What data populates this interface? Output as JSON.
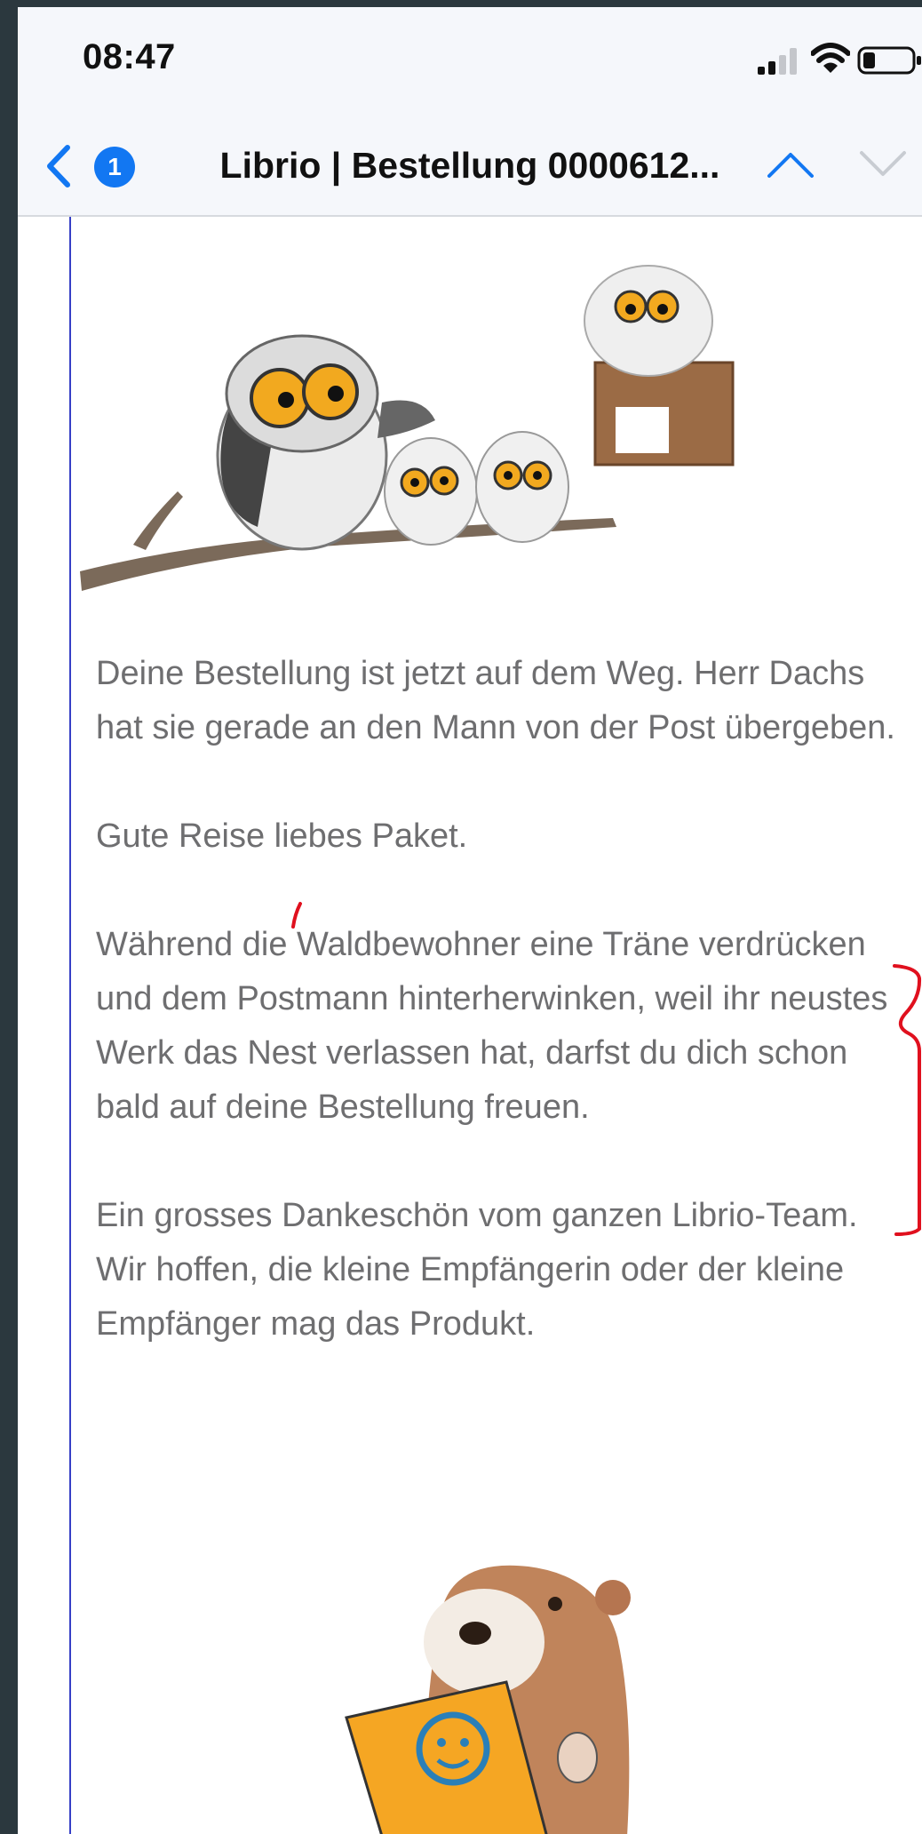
{
  "status_bar": {
    "time": "08:47",
    "signal_icon": "cellular-signal-icon",
    "wifi_icon": "wifi-icon",
    "battery_icon": "battery-low-icon",
    "battery_level": 0.25
  },
  "nav_bar": {
    "back_icon": "chevron-left-icon",
    "unread_count": "1",
    "title": "Librio | Bestellung 0000612...",
    "prev_icon": "chevron-up-icon",
    "next_icon": "chevron-down-icon"
  },
  "illustrations": {
    "header": "owls-on-branch-illustration",
    "footer": "otter-with-clipboard-illustration"
  },
  "email": {
    "paragraphs": [
      "Deine Bestellung ist jetzt auf dem Weg. Herr Dachs hat sie gerade an den Mann von der Post übergeben.",
      "Gute Reise liebes Paket.",
      "Während die Waldbewohner eine Träne verdrücken und dem Postmann hinterherwinken, weil ihr neustes Werk das Nest verlassen hat, darfst du dich schon bald auf deine Bestellung freuen.",
      "Ein grosses Dankeschön vom ganzen Librio-Team. Wir hoffen, die kleine Empfängerin oder der kleine Empfänger mag das Produkt."
    ]
  },
  "annotations": {
    "color": "#e0101e"
  },
  "colors": {
    "accent": "#1277f2",
    "quote_rule": "#3640c6",
    "body_text": "#6e6e70",
    "status_bar_bg": "#f5f7fb"
  }
}
